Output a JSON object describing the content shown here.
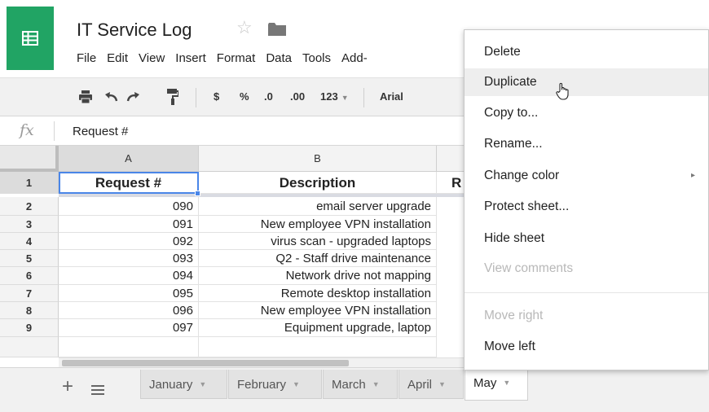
{
  "app": {
    "title": "IT Service Log",
    "star_icon": "star-icon",
    "folder_icon": "folder-icon",
    "logo_color": "#21a464"
  },
  "menubar": [
    "File",
    "Edit",
    "View",
    "Insert",
    "Format",
    "Data",
    "Tools",
    "Add-"
  ],
  "toolbar": {
    "print_icon": "print-icon",
    "undo_icon": "undo-icon",
    "redo_icon": "redo-icon",
    "paint_format_icon": "paint-format-icon",
    "currency": "$",
    "percent": "%",
    "decrease_decimal": ".0",
    "increase_decimal": ".00",
    "more_formats": "123",
    "font": "Arial"
  },
  "formula_bar": {
    "label": "fx",
    "value": "Request #"
  },
  "columns": [
    "A",
    "B"
  ],
  "rows": [
    {
      "num": "1",
      "a": "Request #",
      "b": "Description",
      "c": "R"
    },
    {
      "num": "2",
      "a": "090",
      "b": "email server upgrade"
    },
    {
      "num": "3",
      "a": "091",
      "b": "New employee VPN installation"
    },
    {
      "num": "4",
      "a": "092",
      "b": "virus scan - upgraded laptops"
    },
    {
      "num": "5",
      "a": "093",
      "b": "Q2 - Staff drive maintenance"
    },
    {
      "num": "6",
      "a": "094",
      "b": "Network drive not mapping"
    },
    {
      "num": "7",
      "a": "095",
      "b": "Remote desktop installation"
    },
    {
      "num": "8",
      "a": "096",
      "b": "New employee VPN installation"
    },
    {
      "num": "9",
      "a": "097",
      "b": "Equipment upgrade, laptop"
    }
  ],
  "sheet_tabs": [
    "January",
    "February",
    "March",
    "April",
    "May"
  ],
  "active_tab": "May",
  "context_menu": [
    {
      "label": "Delete",
      "state": "normal"
    },
    {
      "label": "Duplicate",
      "state": "hover"
    },
    {
      "label": "Copy to...",
      "state": "normal"
    },
    {
      "label": "Rename...",
      "state": "normal"
    },
    {
      "label": "Change color",
      "state": "normal",
      "submenu": "▸"
    },
    {
      "label": "Protect sheet...",
      "state": "normal"
    },
    {
      "label": "Hide sheet",
      "state": "normal"
    },
    {
      "label": "View comments",
      "state": "disabled"
    },
    {
      "label": "Move right",
      "state": "disabled"
    },
    {
      "label": "Move left",
      "state": "normal"
    }
  ],
  "colors": {
    "accent": "#4a86e8",
    "hover": "#eeeeee",
    "disabled_text": "#b8b8b8"
  }
}
